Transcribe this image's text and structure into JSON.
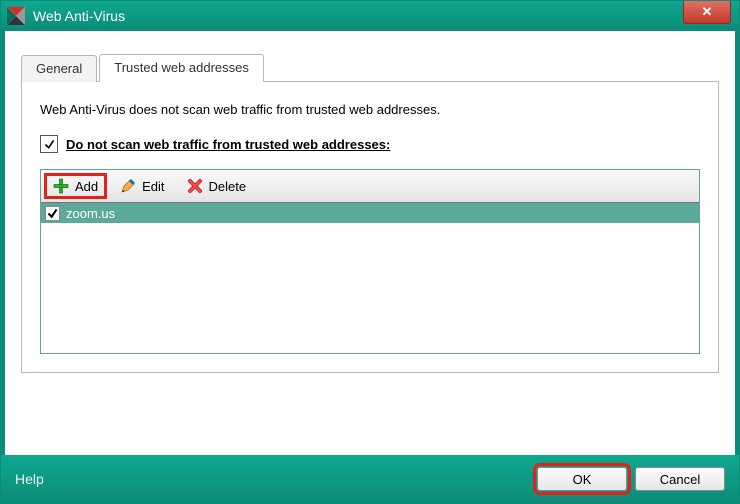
{
  "titlebar": {
    "title": "Web Anti-Virus"
  },
  "tabs": {
    "general": "General",
    "trusted": "Trusted web addresses"
  },
  "panel": {
    "description": "Web Anti-Virus does not scan web traffic from trusted web addresses.",
    "checkbox_label": "Do not scan web traffic from trusted web addresses:",
    "checkbox_checked": true
  },
  "toolbar": {
    "add": "Add",
    "edit": "Edit",
    "delete": "Delete"
  },
  "list": {
    "items": [
      {
        "label": "zoom.us",
        "checked": true
      }
    ]
  },
  "footer": {
    "help": "Help",
    "ok": "OK",
    "cancel": "Cancel"
  }
}
